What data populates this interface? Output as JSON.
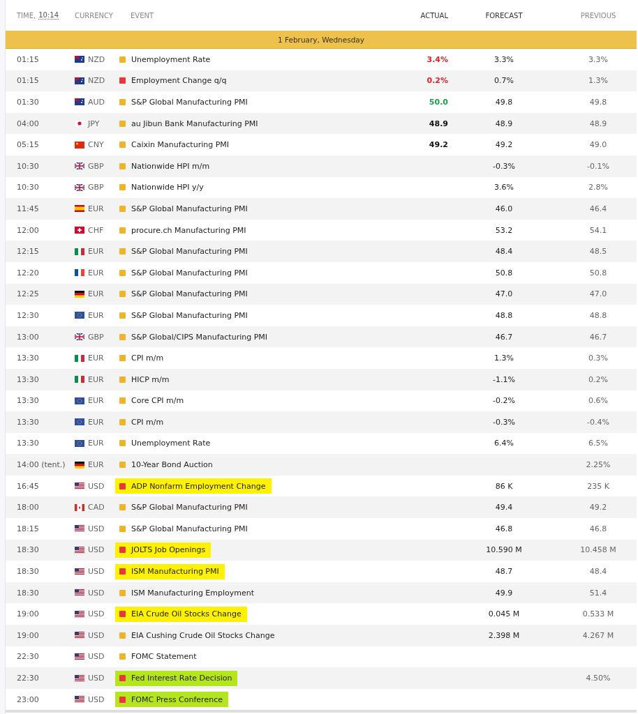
{
  "header": {
    "time_label": "TIME,",
    "clock": "10:14",
    "currency": "CURRENCY",
    "event": "EVENT",
    "actual": "ACTUAL",
    "forecast": "FORECAST",
    "previous": "PREVIOUS"
  },
  "date": "1 February, Wednesday",
  "rows": [
    {
      "time": "01:15",
      "flag": {
        "kind": "nz"
      },
      "currency": "NZD",
      "impact": {
        "color": "#f0b429"
      },
      "event": "Unemployment Rate",
      "actual": {
        "text": "3.4%",
        "color": "#e0202c"
      },
      "forecast": "3.3%",
      "previous": "3.3%"
    },
    {
      "time": "01:15",
      "flag": {
        "kind": "nz"
      },
      "currency": "NZD",
      "impact": {
        "color": "#e8373f"
      },
      "event": "Employment Change q/q",
      "actual": {
        "text": "0.2%",
        "color": "#e0202c"
      },
      "forecast": "0.7%",
      "previous": "1.3%"
    },
    {
      "time": "01:30",
      "flag": {
        "kind": "au"
      },
      "currency": "AUD",
      "impact": {
        "color": "#f0b429"
      },
      "event": "S&P Global Manufacturing PMI",
      "actual": {
        "text": "50.0",
        "color": "#1aa34a"
      },
      "forecast": "49.8",
      "previous": "49.8"
    },
    {
      "time": "04:00",
      "flag": {
        "kind": "jp"
      },
      "currency": "JPY",
      "impact": {
        "color": "#f0b429"
      },
      "event": "au Jibun Bank Manufacturing PMI",
      "actual": {
        "text": "48.9",
        "color": "#111111"
      },
      "forecast": "48.9",
      "previous": "48.9"
    },
    {
      "time": "05:15",
      "flag": {
        "kind": "cn"
      },
      "currency": "CNY",
      "impact": {
        "color": "#f0b429"
      },
      "event": "Caixin Manufacturing PMI",
      "actual": {
        "text": "49.2",
        "color": "#111111"
      },
      "forecast": "49.2",
      "previous": "49.0"
    },
    {
      "time": "10:30",
      "flag": {
        "kind": "gb"
      },
      "currency": "GBP",
      "impact": {
        "color": "#f0b429"
      },
      "event": "Nationwide HPI m/m",
      "forecast": "-0.3%",
      "previous": "-0.1%"
    },
    {
      "time": "10:30",
      "flag": {
        "kind": "gb"
      },
      "currency": "GBP",
      "impact": {
        "color": "#f0b429"
      },
      "event": "Nationwide HPI y/y",
      "forecast": "3.6%",
      "previous": "2.8%"
    },
    {
      "time": "11:45",
      "flag": {
        "kind": "es"
      },
      "currency": "EUR",
      "impact": {
        "color": "#f0b429"
      },
      "event": "S&P Global Manufacturing PMI",
      "forecast": "46.0",
      "previous": "46.4"
    },
    {
      "time": "12:00",
      "flag": {
        "kind": "ch"
      },
      "currency": "CHF",
      "impact": {
        "color": "#f0b429"
      },
      "event": "procure.ch Manufacturing PMI",
      "forecast": "53.2",
      "previous": "54.1"
    },
    {
      "time": "12:15",
      "flag": {
        "kind": "it"
      },
      "currency": "EUR",
      "impact": {
        "color": "#f0b429"
      },
      "event": "S&P Global Manufacturing PMI",
      "forecast": "48.4",
      "previous": "48.5"
    },
    {
      "time": "12:20",
      "flag": {
        "kind": "fr"
      },
      "currency": "EUR",
      "impact": {
        "color": "#f0b429"
      },
      "event": "S&P Global Manufacturing PMI",
      "forecast": "50.8",
      "previous": "50.8"
    },
    {
      "time": "12:25",
      "flag": {
        "kind": "de"
      },
      "currency": "EUR",
      "impact": {
        "color": "#f0b429"
      },
      "event": "S&P Global Manufacturing PMI",
      "forecast": "47.0",
      "previous": "47.0"
    },
    {
      "time": "12:30",
      "flag": {
        "kind": "eu"
      },
      "currency": "EUR",
      "impact": {
        "color": "#f0b429"
      },
      "event": "S&P Global Manufacturing PMI",
      "forecast": "48.8",
      "previous": "48.8"
    },
    {
      "time": "13:00",
      "flag": {
        "kind": "gb"
      },
      "currency": "GBP",
      "impact": {
        "color": "#f0b429"
      },
      "event": "S&P Global/CIPS Manufacturing PMI",
      "forecast": "46.7",
      "previous": "46.7"
    },
    {
      "time": "13:30",
      "flag": {
        "kind": "it"
      },
      "currency": "EUR",
      "impact": {
        "color": "#f0b429"
      },
      "event": "CPI m/m",
      "forecast": "1.3%",
      "previous": "0.3%"
    },
    {
      "time": "13:30",
      "flag": {
        "kind": "it"
      },
      "currency": "EUR",
      "impact": {
        "color": "#f0b429"
      },
      "event": "HICP m/m",
      "forecast": "-1.1%",
      "previous": "0.2%"
    },
    {
      "time": "13:30",
      "flag": {
        "kind": "eu"
      },
      "currency": "EUR",
      "impact": {
        "color": "#f0b429"
      },
      "event": "Core CPI m/m",
      "forecast": "-0.2%",
      "previous": "0.6%"
    },
    {
      "time": "13:30",
      "flag": {
        "kind": "eu"
      },
      "currency": "EUR",
      "impact": {
        "color": "#f0b429"
      },
      "event": "CPI m/m",
      "forecast": "-0.3%",
      "previous": "-0.4%"
    },
    {
      "time": "13:30",
      "flag": {
        "kind": "eu"
      },
      "currency": "EUR",
      "impact": {
        "color": "#f0b429"
      },
      "event": "Unemployment Rate",
      "forecast": "6.4%",
      "previous": "6.5%"
    },
    {
      "time": "14:00 (tent.)",
      "flag": {
        "kind": "de"
      },
      "currency": "EUR",
      "impact": {
        "color": "#f0b429"
      },
      "event": "10-Year Bond Auction",
      "previous": "2.25%"
    },
    {
      "time": "16:45",
      "flag": {
        "kind": "us"
      },
      "currency": "USD",
      "impact": {
        "color": "#e8373f"
      },
      "event": "ADP Nonfarm Employment Change",
      "highlight": {
        "color": "#fff200"
      },
      "forecast": "86 K",
      "previous": "235 K"
    },
    {
      "time": "18:00",
      "flag": {
        "kind": "ca"
      },
      "currency": "CAD",
      "impact": {
        "color": "#f0b429"
      },
      "event": "S&P Global Manufacturing PMI",
      "forecast": "49.4",
      "previous": "49.2"
    },
    {
      "time": "18:15",
      "flag": {
        "kind": "us"
      },
      "currency": "USD",
      "impact": {
        "color": "#f0b429"
      },
      "event": "S&P Global Manufacturing PMI",
      "forecast": "46.8",
      "previous": "46.8"
    },
    {
      "time": "18:30",
      "flag": {
        "kind": "us"
      },
      "currency": "USD",
      "impact": {
        "color": "#e8373f"
      },
      "event": "JOLTS Job Openings",
      "highlight": {
        "color": "#fff200"
      },
      "forecast": "10.590 M",
      "previous": "10.458 M"
    },
    {
      "time": "18:30",
      "flag": {
        "kind": "us"
      },
      "currency": "USD",
      "impact": {
        "color": "#e8373f"
      },
      "event": "ISM Manufacturing PMI",
      "highlight": {
        "color": "#fff200"
      },
      "forecast": "48.7",
      "previous": "48.4"
    },
    {
      "time": "18:30",
      "flag": {
        "kind": "us"
      },
      "currency": "USD",
      "impact": {
        "color": "#f0b429"
      },
      "event": "ISM Manufacturing Employment",
      "forecast": "49.9",
      "previous": "51.4"
    },
    {
      "time": "19:00",
      "flag": {
        "kind": "us"
      },
      "currency": "USD",
      "impact": {
        "color": "#e8373f"
      },
      "event": "EIA Crude Oil Stocks Change",
      "highlight": {
        "color": "#fff200"
      },
      "forecast": "0.045 M",
      "previous": "0.533 M"
    },
    {
      "time": "19:00",
      "flag": {
        "kind": "us"
      },
      "currency": "USD",
      "impact": {
        "color": "#f0b429"
      },
      "event": "EIA Cushing Crude Oil Stocks Change",
      "forecast": "2.398 M",
      "previous": "4.267 M"
    },
    {
      "time": "22:30",
      "flag": {
        "kind": "us"
      },
      "currency": "USD",
      "impact": {
        "color": "#f0b429"
      },
      "event": "FOMC Statement"
    },
    {
      "time": "22:30",
      "flag": {
        "kind": "us"
      },
      "currency": "USD",
      "impact": {
        "color": "#e8373f"
      },
      "event": "Fed Interest Rate Decision",
      "highlight": {
        "color": "#b5e61d"
      },
      "previous": "4.50%"
    },
    {
      "time": "23:00",
      "flag": {
        "kind": "us"
      },
      "currency": "USD",
      "impact": {
        "color": "#e8373f"
      },
      "event": "FOMC Press Conference",
      "highlight": {
        "color": "#b5e61d"
      }
    }
  ]
}
